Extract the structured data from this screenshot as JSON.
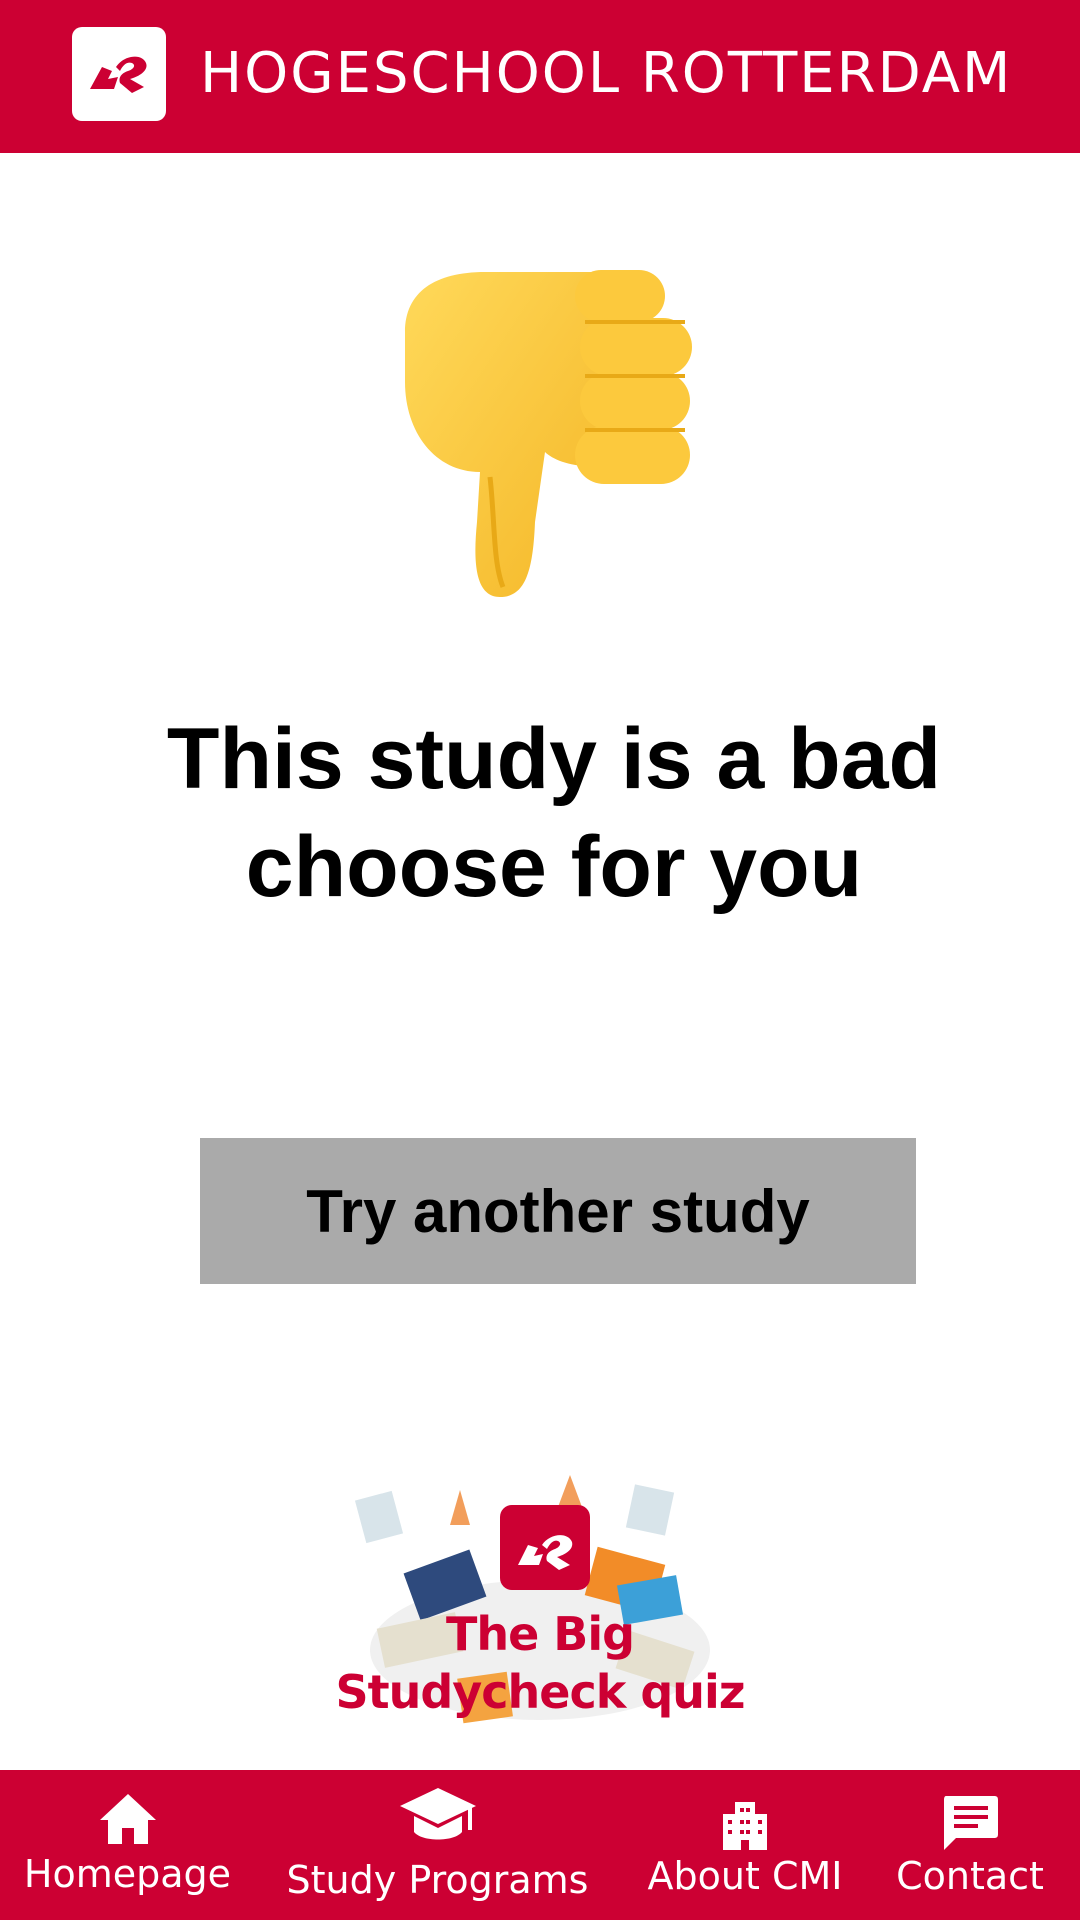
{
  "header": {
    "brand": "HOGESCHOOL ROTTERDAM",
    "logo_icon": "hr-logo-icon"
  },
  "result": {
    "icon": "thumbs-down-icon",
    "message": "This study is a bad choose for you",
    "button_label": "Try another study"
  },
  "quiz_logo": {
    "title": "The Big Studycheck quiz"
  },
  "bottom_nav": {
    "items": [
      {
        "label": "Homepage",
        "icon": "home-icon"
      },
      {
        "label": "Study Programs",
        "icon": "graduation-cap-icon"
      },
      {
        "label": "About CMI",
        "icon": "building-icon"
      },
      {
        "label": "Contact",
        "icon": "chat-icon"
      }
    ]
  },
  "colors": {
    "brand_red": "#cc0033",
    "button_gray": "#aaaaaa",
    "text": "#000000",
    "background": "#ffffff"
  }
}
